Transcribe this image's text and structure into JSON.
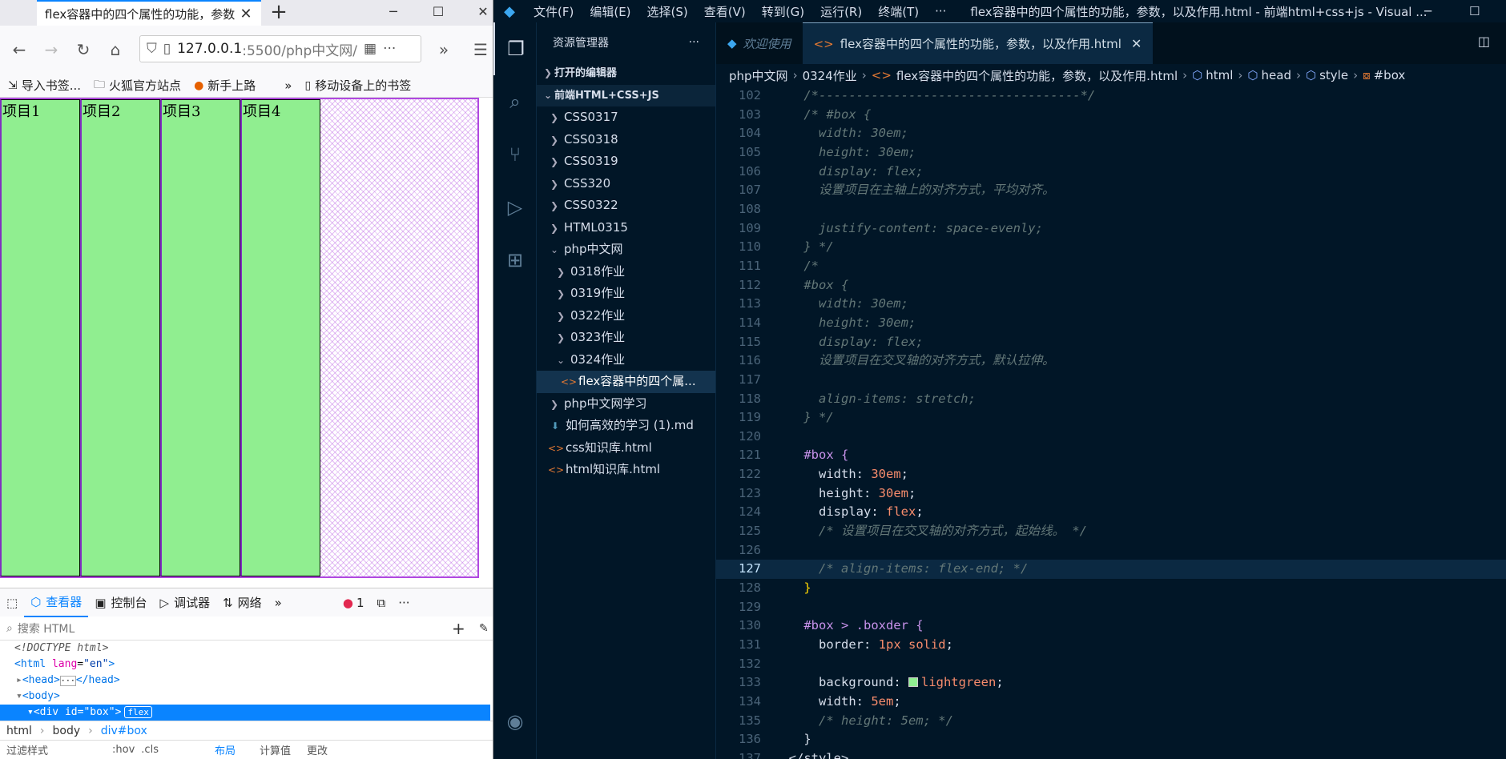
{
  "browser": {
    "tab_title": "flex容器中的四个属性的功能，参数",
    "url_host": "127.0.0.1",
    "url_rest": ":5500/php中文网/",
    "bookmarks": [
      "导入书签...",
      "火狐官方站点",
      "新手上路",
      "移动设备上的书签"
    ],
    "items": [
      "项目1",
      "项目2",
      "项目3",
      "项目4"
    ],
    "devtools": {
      "tabs": [
        "查看器",
        "控制台",
        "调试器",
        "网络"
      ],
      "error_count": "1",
      "search_placeholder": "搜索 HTML",
      "tree": {
        "doctype": "<!DOCTYPE html>",
        "html_tag": "<html",
        "html_attr": "lang",
        "html_val": "\"en\"",
        "head": "<head>",
        "head_close": "</head>",
        "body": "<body>",
        "div_tag": "<div",
        "div_attr": "id",
        "div_val": "\"box\"",
        "flex_badge": "flex"
      },
      "crumbs": [
        "html",
        "body",
        "div#box"
      ],
      "bottom": [
        "过滤样式",
        ":hov",
        ".cls",
        "布局",
        "计算值",
        "更改"
      ]
    }
  },
  "vscode": {
    "menus": [
      "文件(F)",
      "编辑(E)",
      "选择(S)",
      "查看(V)",
      "转到(G)",
      "运行(R)",
      "终端(T)",
      "···"
    ],
    "title": "flex容器中的四个属性的功能，参数，以及作用.html - 前端html+css+js - Visual ...",
    "explorer_title": "资源管理器",
    "sidebar": {
      "open_editors": "打开的编辑器",
      "workspace": "前端HTML+CSS+JS",
      "items": [
        {
          "label": "CSS0317",
          "type": "folder",
          "depth": 1
        },
        {
          "label": "CSS0318",
          "type": "folder",
          "depth": 1
        },
        {
          "label": "CSS0319",
          "type": "folder",
          "depth": 1
        },
        {
          "label": "CSS320",
          "type": "folder",
          "depth": 1
        },
        {
          "label": "CSS0322",
          "type": "folder",
          "depth": 1
        },
        {
          "label": "HTML0315",
          "type": "folder",
          "depth": 1
        },
        {
          "label": "php中文网",
          "type": "folder-open",
          "depth": 1
        },
        {
          "label": "0318作业",
          "type": "folder",
          "depth": 2
        },
        {
          "label": "0319作业",
          "type": "folder",
          "depth": 2
        },
        {
          "label": "0322作业",
          "type": "folder",
          "depth": 2
        },
        {
          "label": "0323作业",
          "type": "folder",
          "depth": 2
        },
        {
          "label": "0324作业",
          "type": "folder-open",
          "depth": 2
        },
        {
          "label": "flex容器中的四个属...",
          "type": "html",
          "depth": 3,
          "selected": true
        },
        {
          "label": "php中文网学习",
          "type": "folder",
          "depth": 1
        },
        {
          "label": "如何高效的学习 (1).md",
          "type": "md",
          "depth": 1
        },
        {
          "label": "css知识库.html",
          "type": "html",
          "depth": 1
        },
        {
          "label": "html知识库.html",
          "type": "html",
          "depth": 1
        }
      ]
    },
    "tabs": [
      "欢迎使用",
      "flex容器中的四个属性的功能，参数，以及作用.html"
    ],
    "breadcrumbs": [
      "php中文网",
      "0324作业",
      "flex容器中的四个属性的功能，参数，以及作用.html",
      "html",
      "head",
      "style",
      "#box"
    ],
    "lines": [
      {
        "n": "102",
        "t": "    /*-----------------------------------*/",
        "k": "com"
      },
      {
        "n": "103",
        "t": "    /* #box {",
        "k": "com"
      },
      {
        "n": "104",
        "t": "      width: 30em;",
        "k": "com"
      },
      {
        "n": "105",
        "t": "      height: 30em;",
        "k": "com"
      },
      {
        "n": "106",
        "t": "      display: flex;",
        "k": "com"
      },
      {
        "n": "107",
        "t": "      设置项目在主轴上的对齐方式，平均对齐。",
        "k": "com"
      },
      {
        "n": "108",
        "t": "",
        "k": "com"
      },
      {
        "n": "109",
        "t": "      justify-content: space-evenly;",
        "k": "com"
      },
      {
        "n": "110",
        "t": "    } */",
        "k": "com"
      },
      {
        "n": "111",
        "t": "    /*",
        "k": "com"
      },
      {
        "n": "112",
        "t": "    #box {",
        "k": "com"
      },
      {
        "n": "113",
        "t": "      width: 30em;",
        "k": "com"
      },
      {
        "n": "114",
        "t": "      height: 30em;",
        "k": "com"
      },
      {
        "n": "115",
        "t": "      display: flex;",
        "k": "com"
      },
      {
        "n": "116",
        "t": "      设置项目在交叉轴的对齐方式，默认拉伸。",
        "k": "com"
      },
      {
        "n": "117",
        "t": "",
        "k": "com"
      },
      {
        "n": "118",
        "t": "      align-items: stretch;",
        "k": "com"
      },
      {
        "n": "119",
        "t": "    } */",
        "k": "com"
      },
      {
        "n": "120",
        "t": "",
        "k": "plain"
      },
      {
        "n": "121",
        "t": "    #box {",
        "k": "sel"
      },
      {
        "n": "122",
        "t": "      width: 30em;",
        "k": "decl",
        "p": "width",
        "v": "30em"
      },
      {
        "n": "123",
        "t": "      height: 30em;",
        "k": "decl",
        "p": "height",
        "v": "30em"
      },
      {
        "n": "124",
        "t": "      display: flex;",
        "k": "decl",
        "p": "display",
        "v": "flex"
      },
      {
        "n": "125",
        "t": "      /* 设置项目在交叉轴的对齐方式，起始线。 */",
        "k": "com"
      },
      {
        "n": "126",
        "t": "",
        "k": "plain"
      },
      {
        "n": "127",
        "t": "      /* align-items: flex-end; */",
        "k": "com",
        "cur": true
      },
      {
        "n": "128",
        "t": "    }",
        "k": "brace"
      },
      {
        "n": "129",
        "t": "",
        "k": "plain"
      },
      {
        "n": "130",
        "t": "    #box > .boxder {",
        "k": "sel"
      },
      {
        "n": "131",
        "t": "      border: 1px solid;",
        "k": "decl",
        "p": "border",
        "v": "1px solid"
      },
      {
        "n": "132",
        "t": "",
        "k": "plain"
      },
      {
        "n": "133",
        "t": "      background: lightgreen;",
        "k": "decl",
        "p": "background",
        "v": "lightgreen",
        "swatch": true
      },
      {
        "n": "134",
        "t": "      width: 5em;",
        "k": "decl",
        "p": "width",
        "v": "5em"
      },
      {
        "n": "135",
        "t": "      /* height: 5em; */",
        "k": "com"
      },
      {
        "n": "136",
        "t": "    }",
        "k": "plain"
      },
      {
        "n": "137",
        "t": "  </style>",
        "k": "plain"
      }
    ]
  }
}
